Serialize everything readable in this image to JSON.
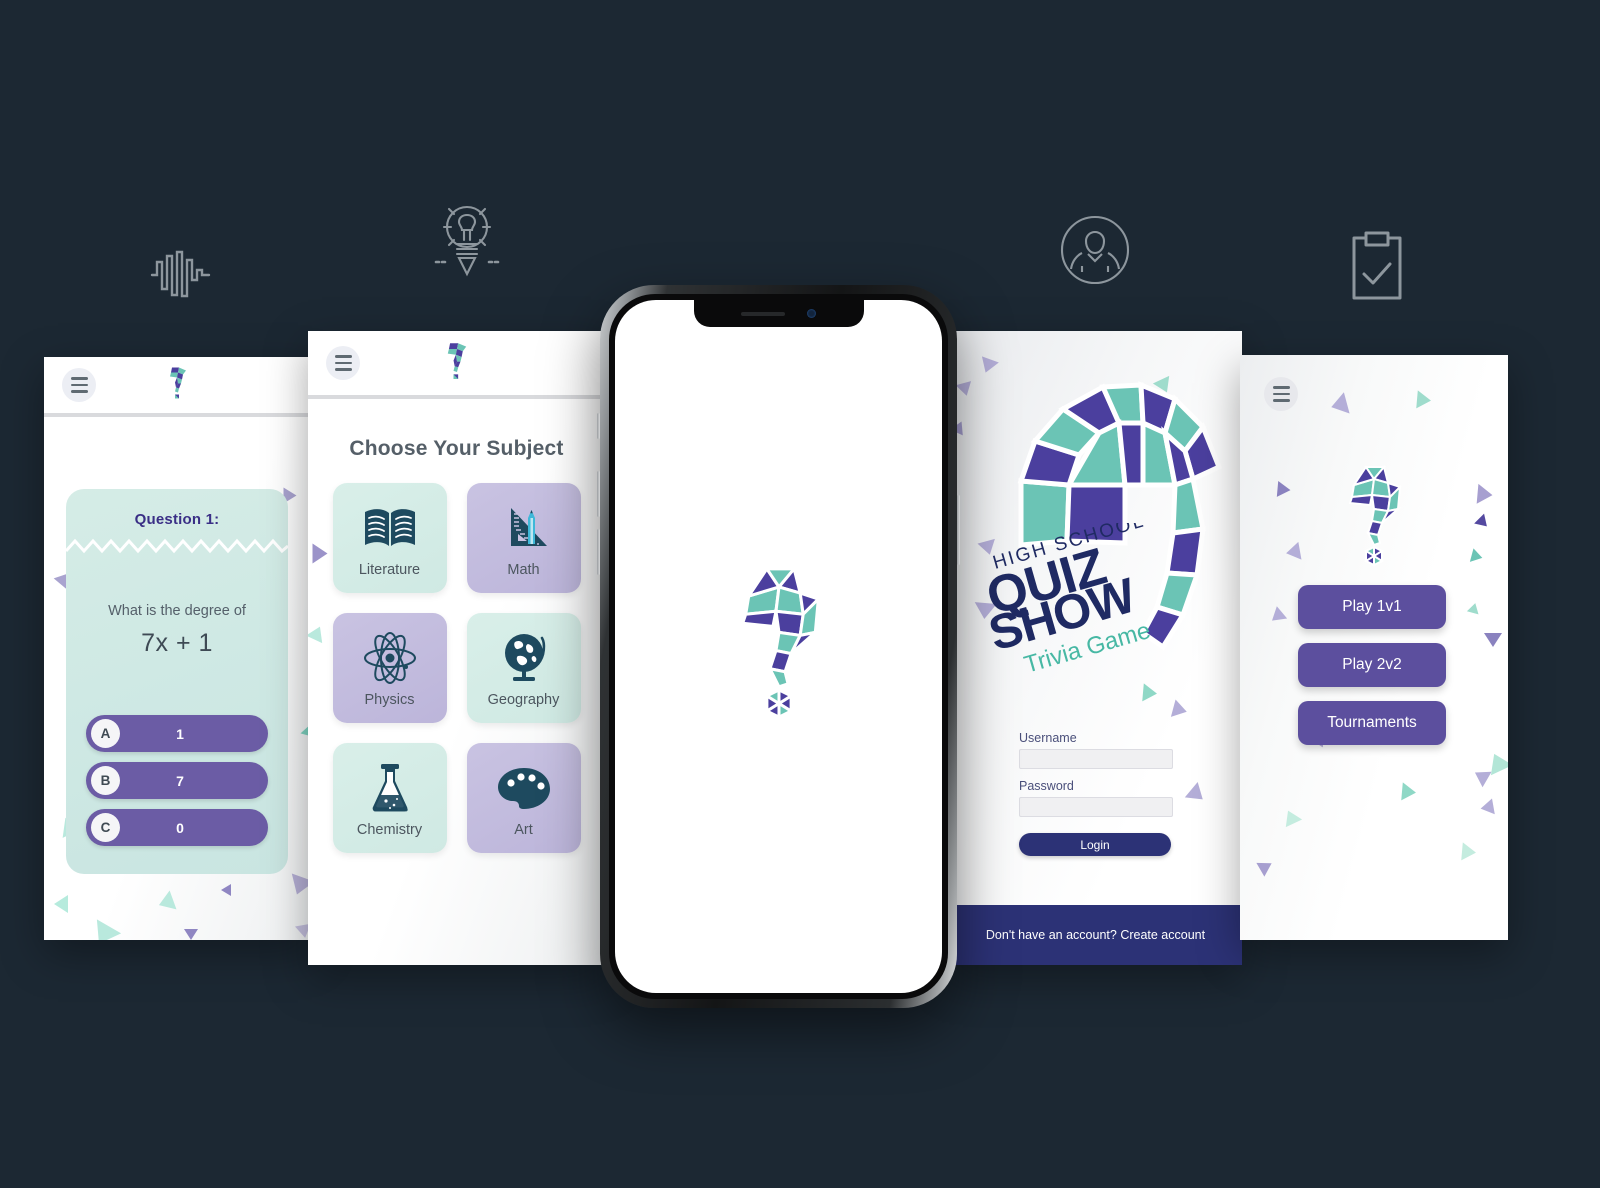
{
  "meta": {
    "background_color": "#1c2833",
    "accent_purple": "#4b3f9e",
    "accent_teal": "#6bc4b5",
    "button_purple": "#5c4f9e",
    "answer_purple": "#6b5ca5",
    "navy": "#2c3276"
  },
  "decorations": [
    {
      "name": "soundwave-icon"
    },
    {
      "name": "lightbulb-pencil-icon"
    },
    {
      "name": "user-avatar-icon"
    },
    {
      "name": "clipboard-check-icon"
    }
  ],
  "screens": {
    "question": {
      "name": "question-screen",
      "header_logo": "quiz-logo-icon",
      "menu": "hamburger-menu",
      "card_title": "Question 1:",
      "prompt": "What is the degree of",
      "expression": "7x + 1",
      "answers": [
        {
          "letter": "A",
          "value": "1"
        },
        {
          "letter": "B",
          "value": "7"
        },
        {
          "letter": "C",
          "value": "0"
        }
      ]
    },
    "subjects": {
      "name": "subject-select-screen",
      "header_logo": "quiz-logo-icon",
      "menu": "hamburger-menu",
      "title": "Choose Your Subject",
      "items": [
        {
          "label": "Literature",
          "icon": "open-book-icon",
          "tone": "teal"
        },
        {
          "label": "Math",
          "icon": "ruler-pencil-icon",
          "tone": "lilac"
        },
        {
          "label": "Physics",
          "icon": "atom-icon",
          "tone": "lilac"
        },
        {
          "label": "Geography",
          "icon": "globe-icon",
          "tone": "teal"
        },
        {
          "label": "Chemistry",
          "icon": "flask-icon",
          "tone": "teal"
        },
        {
          "label": "Art",
          "icon": "palette-icon",
          "tone": "lilac"
        }
      ]
    },
    "login": {
      "name": "login-screen",
      "logo_icon": "quiz-mosaic-question-mark",
      "wordmark": {
        "line1": "HIGH SCHOOL",
        "line2": "QUIZ",
        "line3": "SHOW",
        "line4": "Trivia Game"
      },
      "username_label": "Username",
      "username_value": "",
      "username_placeholder": "",
      "password_label": "Password",
      "password_value": "",
      "password_placeholder": "",
      "login_button": "Login",
      "footer_text": "Don't have an account? Create account"
    },
    "play": {
      "name": "play-menu-screen",
      "menu": "hamburger-menu",
      "logo_icon": "quiz-mosaic-question-mark",
      "buttons": [
        {
          "label": "Play 1v1"
        },
        {
          "label": "Play 2v2"
        },
        {
          "label": "Tournaments"
        }
      ]
    },
    "device": {
      "name": "iphone-mockup",
      "splash_logo": "quiz-mosaic-question-mark"
    }
  }
}
